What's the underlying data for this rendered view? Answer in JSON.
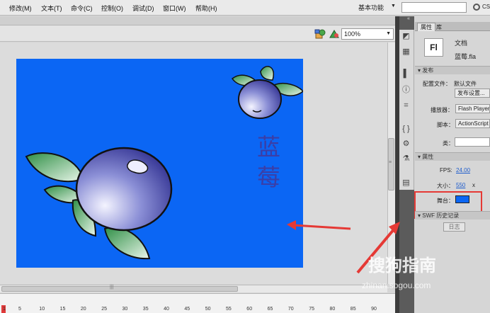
{
  "menu": {
    "items": [
      "修改(M)",
      "文本(T)",
      "命令(C)",
      "控制(O)",
      "调试(D)",
      "窗口(W)",
      "帮助(H)"
    ],
    "workspace_label": "基本功能",
    "search_label": "CS"
  },
  "toolbar": {
    "zoom_value": "100%"
  },
  "stage": {
    "background_color": "#0b66f4",
    "title_chars": [
      "蓝",
      "莓"
    ]
  },
  "timeline": {
    "frame_numbers": [
      "1",
      "5",
      "10",
      "15",
      "20",
      "25",
      "30",
      "35",
      "40",
      "45",
      "50",
      "55",
      "60",
      "65",
      "70",
      "75",
      "80",
      "85",
      "90"
    ]
  },
  "panel": {
    "tabs": [
      "属性",
      "库"
    ],
    "doc_logo": "Fl",
    "doc_type": "文档",
    "doc_name": "蓝莓.fla",
    "publish_section": "发布",
    "profile_label": "配置文件：",
    "profile_value": "默认文件",
    "publish_settings_button": "发布设置...",
    "player_label": "播放器：",
    "player_value": "Flash Player",
    "script_label": "脚本：",
    "script_value": "ActionScript",
    "class_label": "类：",
    "properties_section": "属性",
    "fps_label": "FPS:",
    "fps_value": "24.00",
    "size_label": "大小：",
    "size_value": "550",
    "size_unit": "x",
    "stage_label": "舞台：",
    "stage_color": "#0b66f4",
    "swf_section": "SWF 历史记录",
    "log_button": "日志"
  },
  "watermark": {
    "brand": "搜狗指南",
    "url": "zhinan.sogou.com"
  },
  "icons": [
    "edit-symbols-icon",
    "edit-scene-icon",
    "panel-collapse-icon",
    "swatches-icon",
    "grid-icon",
    "align-icon",
    "info-icon",
    "transform-icon",
    "code-icon",
    "components-icon",
    "motion-icon",
    "output-icon"
  ],
  "colors": {
    "highlight": "#e53935",
    "link": "#1e5ccc"
  }
}
